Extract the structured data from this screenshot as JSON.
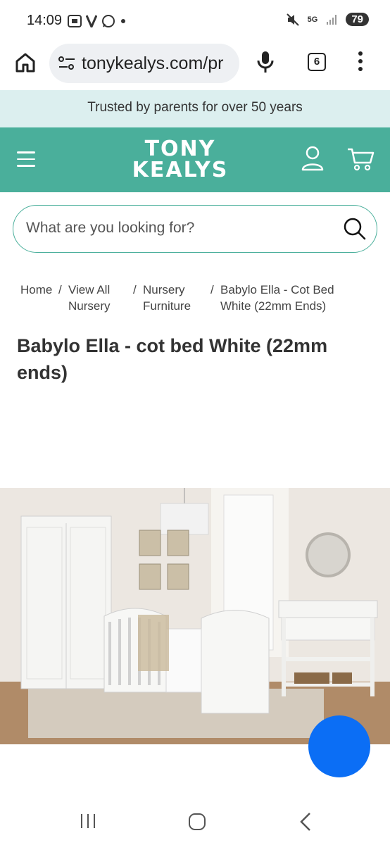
{
  "status_bar": {
    "time": "14:09",
    "battery": "79",
    "network": "5G"
  },
  "browser": {
    "url": "tonykealys.com/pr",
    "tab_count": "6"
  },
  "announcement": "Trusted by parents for over 50 years",
  "header": {
    "logo_line1": "TONY",
    "logo_line2": "KEALYS",
    "brand_color": "#4aaf9b"
  },
  "search": {
    "placeholder": "What are you looking for?"
  },
  "breadcrumb": [
    {
      "label_line1": "Home",
      "label_line2": ""
    },
    {
      "label_line1": "View All",
      "label_line2": "Nursery"
    },
    {
      "label_line1": "Nursery",
      "label_line2": "Furniture"
    },
    {
      "label_line1": "Babylo Ella - Cot Bed",
      "label_line2": "White (22mm Ends)"
    }
  ],
  "product": {
    "title": "Babylo Ella - cot bed White (22mm ends)"
  },
  "chat_fab_color": "#0b6ef5"
}
